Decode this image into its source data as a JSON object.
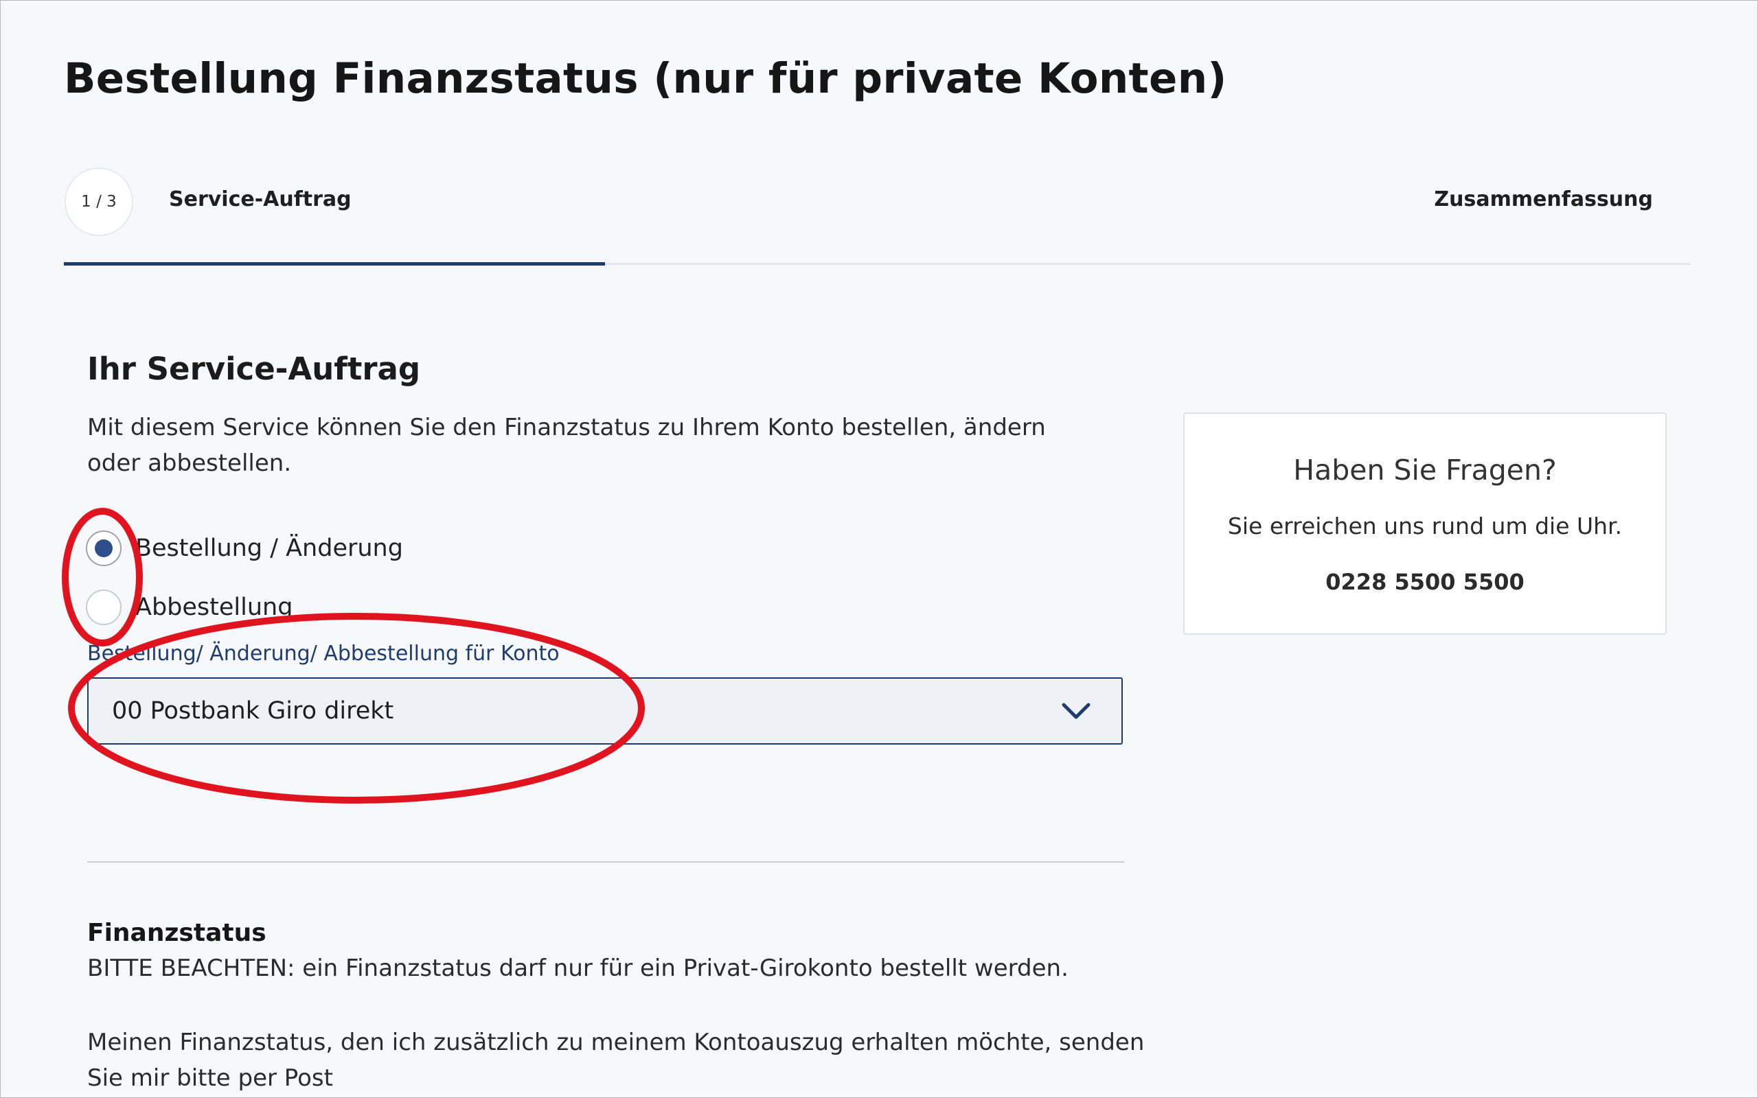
{
  "page": {
    "title": "Bestellung Finanzstatus (nur für private Konten)"
  },
  "stepper": {
    "counter": "1 / 3",
    "current_label": "Service-Auftrag",
    "last_label": "Zusammenfassung",
    "progress": 0.33
  },
  "service": {
    "heading": "Ihr Service-Auftrag",
    "intro": "Mit diesem Service können Sie den Finanzstatus zu Ihrem Konto bestellen, ändern oder abbestellen.",
    "options": [
      {
        "label": "Bestellung / Änderung",
        "selected": true
      },
      {
        "label": "Abbestellung",
        "selected": false
      }
    ],
    "account_field_label": "Bestellung/ Änderung/ Abbestellung für Konto",
    "account_value": "00 Postbank Giro direkt"
  },
  "finanzstatus": {
    "title": "Finanzstatus",
    "note": "BITTE BEACHTEN: ein Finanzstatus darf nur für ein Privat-Girokonto bestellt werden.",
    "description": "Meinen Finanzstatus, den ich zusätzlich zu meinem Kontoauszug erhalten möchte, senden Sie mir bitte per Post"
  },
  "help": {
    "title": "Haben Sie Fragen?",
    "text": "Sie erreichen uns rund um die Uhr.",
    "phone": "0228 5500 5500"
  },
  "colors": {
    "brand": "#1e3c6e",
    "radio_selected": "#2e4f8a",
    "annotation": "#e0141e",
    "background": "#f7f8fa"
  },
  "icons": {
    "select_indicator": "chevron-down-icon"
  }
}
